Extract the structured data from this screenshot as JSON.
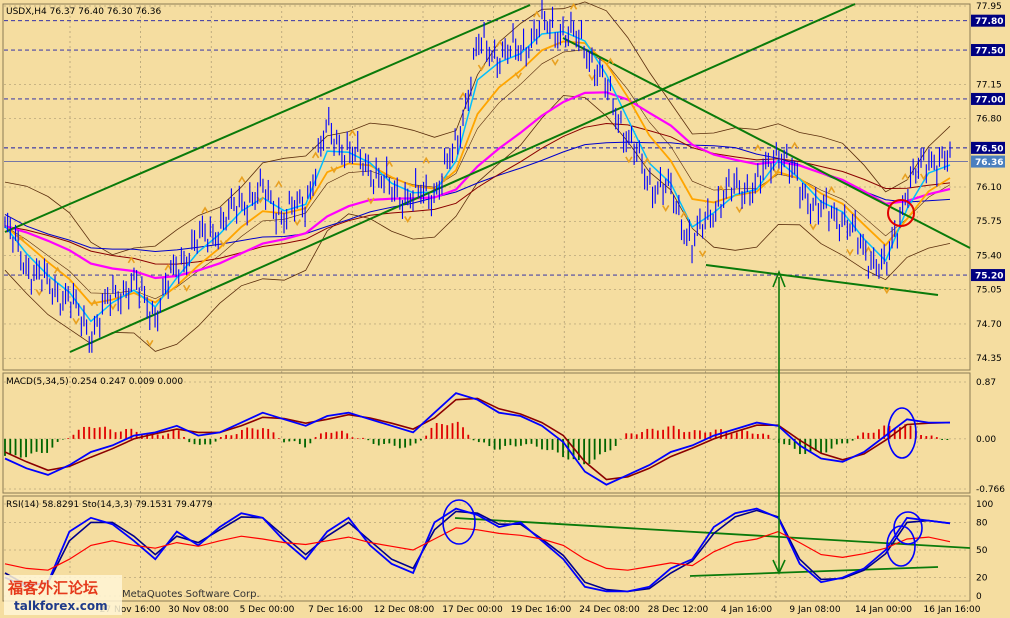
{
  "colors": {
    "background": "#F5DDA0",
    "grid": "#9A8C6A",
    "price_line": "#0000FF",
    "ma_magenta": "#FF00FF",
    "ma_blue": "#0000CC",
    "ma_orange": "#FFA500",
    "ma_cyan": "#00BFFF",
    "ma_darkred": "#8B0000",
    "bollinger": "#5A2D0C",
    "trend": "#0A7A0A",
    "fractal": "#E8A020",
    "macd_main": "#0000FF",
    "macd_signal": "#8B0000",
    "hist_up": "#E00000",
    "hist_down": "#006400",
    "rsi": "#FF0000",
    "stoch_main": "#0000FF",
    "stoch_signal": "#00008B",
    "badge_bg": "#000080",
    "badge_last": "#4A7FBF",
    "circle_red": "#E00000",
    "circle_blue": "#0000FF",
    "arrow_green": "#0A7A0A"
  },
  "chart_data": [
    {
      "type": "line",
      "title": "USDX,H4 76.37 76.40 76.30 76.36",
      "instrument": "USDX",
      "timeframe": "H4",
      "ohlc": {
        "open": 76.37,
        "high": 76.4,
        "low": 76.3,
        "close": 76.36
      },
      "ylim": [
        74.25,
        77.95
      ],
      "y_ticks": [
        "77.95",
        "77.80",
        "77.50",
        "77.15",
        "77.00",
        "76.80",
        "76.50",
        "76.36",
        "76.10",
        "75.75",
        "75.40",
        "75.20",
        "75.05",
        "74.70",
        "74.35"
      ],
      "highlighted_levels": [
        "77.80",
        "77.50",
        "77.00",
        "76.50",
        "75.20"
      ],
      "current_price": "76.36",
      "x_ticks": [
        "27 Nov 16:00",
        "30 Nov 08:00",
        "5 Dec 00:00",
        "7 Dec 16:00",
        "12 Dec 08:00",
        "17 Dec 00:00",
        "19 Dec 16:00",
        "24 Dec 08:00",
        "28 Dec 12:00",
        "4 Jan 16:00",
        "9 Jan 08:00",
        "14 Jan 00:00",
        "16 Jan 16:00"
      ],
      "series": [
        {
          "name": "",
          "x": [
            "20 Nov",
            "21 Nov",
            "22 Nov",
            "23 Nov",
            "24 Nov",
            "27 Nov",
            "28 Nov",
            "29 Nov",
            "30 Nov",
            "1 Dec",
            "4 Dec",
            "5 Dec",
            "6 Dec",
            "7 Dec",
            "8 Dec",
            "11 Dec",
            "12 Dec",
            "13 Dec",
            "14 Dec",
            "15 Dec",
            "17 Dec",
            "18 Dec",
            "19 Dec",
            "20 Dec",
            "21 Dec",
            "22 Dec",
            "24 Dec",
            "26 Dec",
            "27 Dec",
            "28 Dec",
            "29 Dec",
            "2 Jan",
            "3 Jan",
            "4 Jan",
            "5 Jan",
            "8 Jan",
            "9 Jan",
            "10 Jan",
            "11 Jan",
            "12 Jan",
            "14 Jan",
            "15 Jan",
            "16 Jan",
            "17 Jan",
            "18 Jan"
          ],
          "values": [
            75.7,
            75.3,
            75.1,
            74.95,
            74.6,
            75.0,
            75.1,
            74.8,
            75.3,
            75.55,
            75.7,
            75.95,
            76.05,
            75.8,
            75.95,
            76.7,
            76.45,
            76.3,
            76.05,
            76.0,
            76.05,
            76.5,
            77.55,
            77.45,
            77.5,
            77.75,
            77.7,
            77.55,
            77.1,
            76.6,
            76.15,
            76.05,
            75.5,
            75.9,
            76.1,
            76.1,
            76.5,
            76.1,
            75.85,
            75.8,
            75.45,
            75.25,
            76.1,
            76.4,
            76.36
          ]
        }
      ]
    },
    {
      "type": "bar",
      "title": "MACD(5,34,5) 0.254 0.247 0.009 0.000",
      "ylim": [
        -0.766,
        0.87
      ],
      "y_ticks": [
        "0.87",
        "0.00",
        "-0.766"
      ],
      "series": [
        {
          "name": "",
          "values": [
            -0.3,
            -0.45,
            -0.55,
            -0.4,
            -0.2,
            -0.1,
            0.05,
            0.1,
            0.2,
            0.05,
            0.1,
            0.25,
            0.4,
            0.3,
            0.2,
            0.35,
            0.4,
            0.3,
            0.2,
            0.1,
            0.4,
            0.7,
            0.6,
            0.4,
            0.35,
            0.2,
            -0.05,
            -0.5,
            -0.7,
            -0.55,
            -0.4,
            -0.2,
            -0.1,
            0.05,
            0.15,
            0.25,
            0.2,
            -0.1,
            -0.3,
            -0.35,
            -0.2,
            0.05,
            0.3,
            0.25,
            0.25
          ]
        },
        {
          "name": "",
          "values": [
            -0.2,
            -0.35,
            -0.48,
            -0.42,
            -0.28,
            -0.15,
            0.0,
            0.08,
            0.15,
            0.1,
            0.1,
            0.2,
            0.33,
            0.31,
            0.24,
            0.3,
            0.37,
            0.32,
            0.24,
            0.15,
            0.32,
            0.6,
            0.62,
            0.46,
            0.38,
            0.25,
            0.05,
            -0.35,
            -0.62,
            -0.58,
            -0.45,
            -0.27,
            -0.14,
            0.0,
            0.11,
            0.21,
            0.21,
            -0.02,
            -0.22,
            -0.32,
            -0.23,
            -0.02,
            0.22,
            0.24,
            0.25
          ]
        }
      ]
    },
    {
      "type": "line",
      "title": "RSI(14) 58.8291 Sto(14,3,3) 79.1531 79.4779",
      "ylim": [
        0,
        100
      ],
      "y_ticks": [
        "100",
        "80",
        "50",
        "20",
        "0"
      ],
      "series": [
        {
          "name": "",
          "values": [
            35,
            30,
            28,
            40,
            55,
            60,
            55,
            52,
            58,
            54,
            60,
            65,
            62,
            58,
            56,
            60,
            64,
            58,
            54,
            50,
            62,
            74,
            72,
            68,
            66,
            62,
            55,
            40,
            30,
            28,
            32,
            36,
            33,
            48,
            58,
            62,
            70,
            58,
            45,
            42,
            46,
            52,
            62,
            64,
            59
          ]
        },
        {
          "name": "",
          "values": [
            20,
            10,
            15,
            70,
            85,
            78,
            60,
            40,
            70,
            55,
            75,
            90,
            85,
            60,
            40,
            70,
            85,
            55,
            35,
            25,
            80,
            95,
            88,
            75,
            80,
            60,
            40,
            10,
            5,
            5,
            10,
            30,
            40,
            75,
            90,
            95,
            85,
            35,
            15,
            20,
            30,
            50,
            85,
            82,
            79
          ]
        },
        {
          "name": "",
          "values": [
            25,
            12,
            14,
            60,
            80,
            80,
            65,
            45,
            65,
            58,
            72,
            86,
            85,
            65,
            45,
            65,
            80,
            60,
            40,
            30,
            72,
            92,
            90,
            78,
            78,
            62,
            44,
            15,
            7,
            5,
            8,
            25,
            38,
            68,
            86,
            93,
            86,
            40,
            18,
            19,
            28,
            46,
            80,
            82,
            79
          ]
        }
      ]
    }
  ],
  "annotations": {
    "watermark": "MetaQuotes Software Corp.",
    "logo_cn": "福客外汇论坛",
    "logo_en": "talkforex.com"
  }
}
